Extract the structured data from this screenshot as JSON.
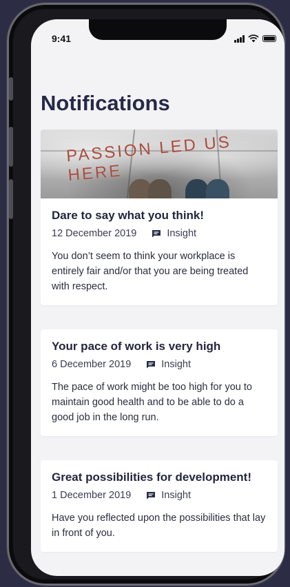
{
  "status_bar": {
    "time": "9:41"
  },
  "page": {
    "title": "Notifications"
  },
  "cards": [
    {
      "image_text": "PASSION LED US HERE",
      "title": "Dare to say what you think!",
      "date": "12 December 2019",
      "tag": "Insight",
      "description": "You don’t seem to think your workplace is entirely fair and/or that you are being treated with respect."
    },
    {
      "title": "Your pace of work is very high",
      "date": "6 December 2019",
      "tag": "Insight",
      "description": "The pace of work might be too high for you to maintain good health and to be able to do a good job in the long run."
    },
    {
      "title": "Great possibilities for development!",
      "date": "1 December 2019",
      "tag": "Insight",
      "description": "Have you reflected upon the possibilities that lay in front of you."
    }
  ],
  "icons": {
    "tag_icon": "message-square-icon",
    "signal": "signal-icon",
    "wifi": "wifi-icon",
    "battery": "battery-icon"
  },
  "colors": {
    "title": "#262a47",
    "background": "#f3f3f6",
    "frame_bg": "#2c2c44"
  }
}
